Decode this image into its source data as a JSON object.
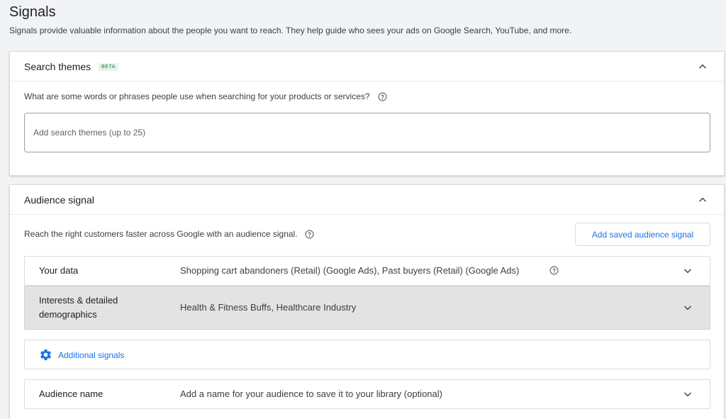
{
  "header": {
    "title": "Signals",
    "description": "Signals provide valuable information about the people you want to reach. They help guide who sees your ads on Google Search, YouTube, and more."
  },
  "search_themes": {
    "title": "Search themes",
    "badge": "BETA",
    "question": "What are some words or phrases people use when searching for your products or services?",
    "input_placeholder": "Add search themes (up to 25)",
    "input_value": ""
  },
  "audience_signal": {
    "title": "Audience signal",
    "description": "Reach the right customers faster across Google with an audience signal.",
    "saved_button_label": "Add saved audience signal",
    "rows": [
      {
        "label": "Your data",
        "value": "Shopping cart abandoners (Retail) (Google Ads), Past buyers (Retail) (Google Ads)"
      },
      {
        "label": "Interests & detailed demographics",
        "value": "Health & Fitness Buffs, Healthcare Industry"
      }
    ],
    "additional_signals_label": "Additional signals",
    "audience_name": {
      "label": "Audience name",
      "value": "Add a name for your audience to save it to your library (optional)"
    }
  },
  "colors": {
    "accent": "#1a73e8",
    "badge_text": "#188038",
    "badge_bg": "#e6f4ea",
    "selected_row": "#e3e3e3",
    "page_bg": "#f1f3f4"
  },
  "icons": {
    "collapse": "chevron-up-icon",
    "expand": "chevron-down-icon",
    "help": "help-circle-icon",
    "settings": "gear-icon"
  }
}
